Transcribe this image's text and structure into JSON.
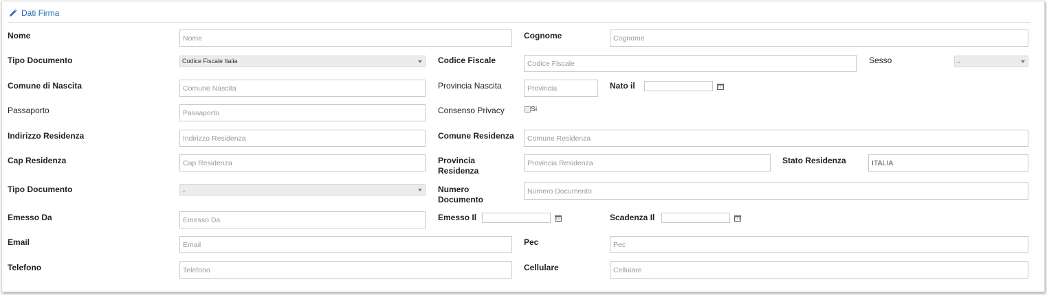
{
  "section": {
    "title": "Dati Firma",
    "icon": "pencil-icon"
  },
  "labels": {
    "nome": "Nome",
    "cognome": "Cognome",
    "tipo_documento_1": "Tipo Documento",
    "codice_fiscale": "Codice Fiscale",
    "sesso": "Sesso",
    "comune_nascita": "Comune di Nascita",
    "provincia_nascita": "Provincia Nascita",
    "nato_il": "Nato il",
    "passaporto": "Passaporto",
    "consenso_privacy": "Consenso Privacy",
    "indirizzo_residenza": "Indirizzo Residenza",
    "comune_residenza": "Comune Residenza",
    "cap_residenza": "Cap Residenza",
    "provincia_residenza_1": "Provincia",
    "provincia_residenza_2": "Residenza",
    "stato_residenza": "Stato Residenza",
    "tipo_documento_2": "Tipo Documento",
    "numero_documento_1": "Numero",
    "numero_documento_2": "Documento",
    "emesso_da": "Emesso Da",
    "emesso_il": "Emesso Il",
    "scadenza_il": "Scadenza Il",
    "email": "Email",
    "pec": "Pec",
    "telefono": "Telefono",
    "cellulare": "Cellulare"
  },
  "placeholders": {
    "nome": "Nome",
    "cognome": "Cognome",
    "codice_fiscale": "Codice Fiscale",
    "comune_nascita": "Comune Nascita",
    "provincia_nascita": "Provincia",
    "passaporto": "Passaporto",
    "indirizzo_residenza": "Indirizzo Residenza",
    "comune_residenza": "Comune Residenza",
    "cap_residenza": "Cap Residenza",
    "provincia_residenza": "Provincia Residenza",
    "numero_documento": "Numero Documento",
    "emesso_da": "Emesso Da",
    "email": "Email",
    "pec": "Pec",
    "telefono": "Telefono",
    "cellulare": "Cellulare"
  },
  "values": {
    "stato_residenza": "ITALIA"
  },
  "selects": {
    "tipo_documento_1": "Codice Fiscale Italia",
    "sesso": "..",
    "tipo_documento_2": ".."
  },
  "checkboxes": {
    "consenso_privacy_option": "Sì"
  },
  "colors": {
    "accent": "#2a6db5",
    "border": "#c8c8c8",
    "select_bg": "#ececec"
  }
}
